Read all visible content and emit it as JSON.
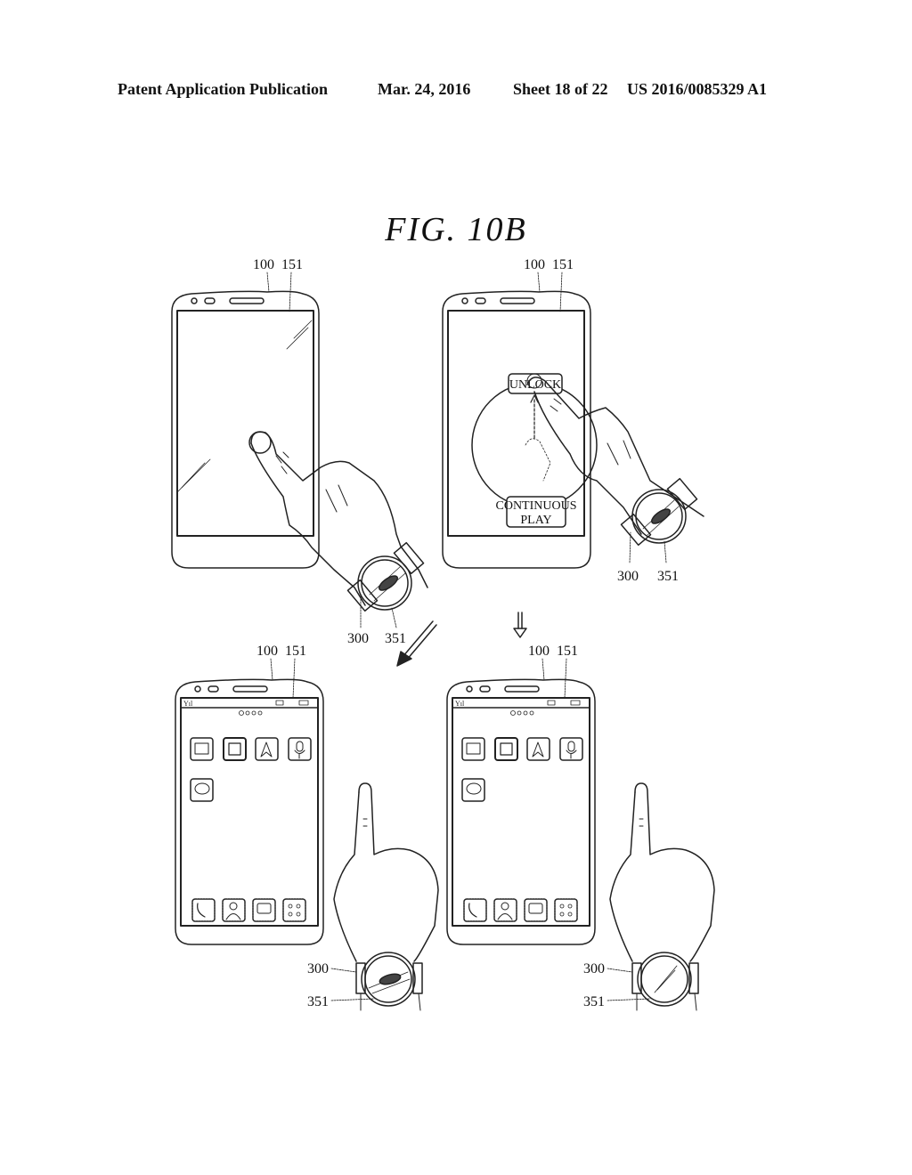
{
  "header": {
    "publication_type": "Patent Application Publication",
    "date": "Mar. 24, 2016",
    "sheet": "Sheet 18 of 22",
    "publication_number": "US 2016/0085329 A1"
  },
  "figure": {
    "title": "FIG.  10B"
  },
  "reference_numerals": {
    "mobile_terminal": "100",
    "display_unit": "151",
    "watch": "300",
    "watch_display": "351"
  },
  "panels": {
    "top_left": {
      "description": "Finger touches blank lock screen of mobile terminal while wearing watch showing car icon"
    },
    "top_right": {
      "unlock_button": "UNLOCK",
      "continuous_play_button_line1": "CONTINUOUS",
      "continuous_play_button_line2": "PLAY"
    },
    "bottom_left": {
      "description": "Home screen displayed; watch still shows car icon"
    },
    "bottom_right": {
      "description": "Home screen displayed; watch display turned off"
    }
  },
  "home_screen": {
    "app_icons": [
      "folder-icon",
      "document-icon",
      "navigation-icon",
      "microphone-icon",
      "chat-icon"
    ],
    "dock_icons": [
      "phone-icon",
      "contacts-icon",
      "message-icon",
      "apps-grid-icon"
    ],
    "page_indicator_count": 4
  }
}
